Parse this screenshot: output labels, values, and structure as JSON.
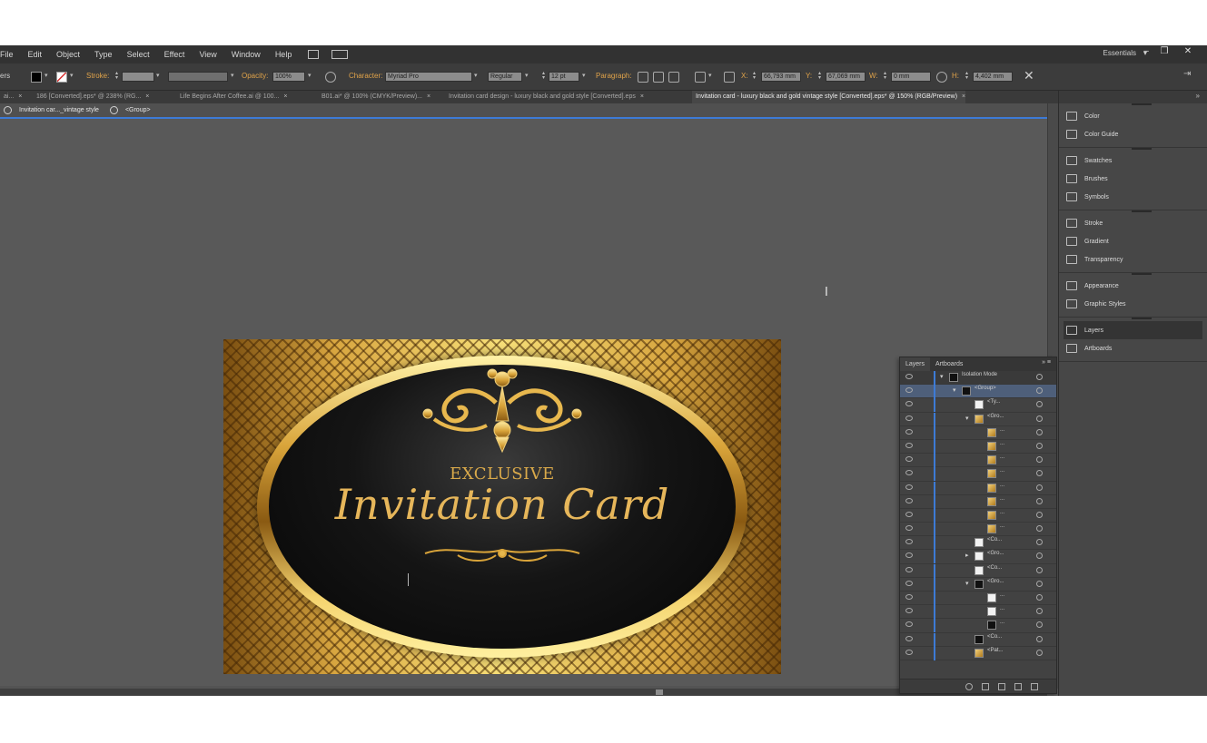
{
  "menubar": {
    "items": [
      "File",
      "Edit",
      "Object",
      "Type",
      "Select",
      "Effect",
      "View",
      "Window",
      "Help"
    ],
    "workspace_label": "Essentials",
    "workspace_caret": "▾",
    "win_minimize": "–",
    "win_restore": "❐",
    "win_close": "✕"
  },
  "controlbar": {
    "prefix_label": "ers",
    "stroke_label": "Stroke:",
    "opacity_label": "Opacity:",
    "opacity_value": "100%",
    "character_label": "Character:",
    "font_value": "Myriad Pro",
    "style_value": "Regular",
    "size_value": "12 pt",
    "paragraph_label": "Paragraph:",
    "x_label": "X:",
    "x_value": "66,793 mm",
    "y_label": "Y:",
    "y_value": "67,069 mm",
    "w_label": "W:",
    "w_value": "0 mm",
    "h_label": "H:",
    "h_value": "4,402 mm",
    "fill_color": "#000000",
    "stroke_color": "#d83030"
  },
  "tabs": [
    {
      "label": "ai..."
    },
    {
      "label": "186 [Converted].eps* @ 238% (RG..."
    },
    {
      "label": "Life Begins After Coffee.ai @ 100..."
    },
    {
      "label": "B01.ai* @ 100% (CMYK/Preview)..."
    },
    {
      "label": "Invitation card design - luxury black and gold style [Converted].eps"
    },
    {
      "label": "Invitation card - luxury black and gold vintage style [Converted].eps* @ 150% (RGB/Preview)"
    }
  ],
  "tab_close": "×",
  "breadcrumb": {
    "items": [
      "Invitation car..._vintage style",
      "<Group>"
    ]
  },
  "artwork": {
    "subtitle": "EXCLUSIVE",
    "title": "Invitation Card"
  },
  "cursor": {
    "ibeam": "I"
  },
  "dock": {
    "collapse": "»",
    "groups": [
      [
        {
          "label": "Color",
          "icon": "color-icon"
        },
        {
          "label": "Color Guide",
          "icon": "color-guide-icon"
        }
      ],
      [
        {
          "label": "Swatches",
          "icon": "swatches-icon"
        },
        {
          "label": "Brushes",
          "icon": "brushes-icon"
        },
        {
          "label": "Symbols",
          "icon": "symbols-icon"
        }
      ],
      [
        {
          "label": "Stroke",
          "icon": "stroke-icon"
        },
        {
          "label": "Gradient",
          "icon": "gradient-icon"
        },
        {
          "label": "Transparency",
          "icon": "transparency-icon"
        }
      ],
      [
        {
          "label": "Appearance",
          "icon": "appearance-icon"
        },
        {
          "label": "Graphic Styles",
          "icon": "graphic-styles-icon"
        }
      ],
      [
        {
          "label": "Layers",
          "icon": "layers-icon",
          "selected": true
        },
        {
          "label": "Artboards",
          "icon": "artboards-icon"
        }
      ]
    ]
  },
  "layers": {
    "tabs": [
      "Layers",
      "Artboards"
    ],
    "menu": "»  ≡",
    "rows": [
      {
        "name": "Isolation Mode",
        "depth": 0,
        "expander": "▾",
        "thumb": "black",
        "state": "isolated"
      },
      {
        "name": "<Group>",
        "depth": 1,
        "expander": "▾",
        "thumb": "black",
        "state": "selected"
      },
      {
        "name": "<Ty...",
        "depth": 2,
        "expander": "",
        "thumb": "white",
        "state": ""
      },
      {
        "name": "<Gro...",
        "depth": 2,
        "expander": "▾",
        "thumb": "gold",
        "state": ""
      },
      {
        "name": "...",
        "depth": 3,
        "expander": "",
        "thumb": "gold",
        "state": ""
      },
      {
        "name": "...",
        "depth": 3,
        "expander": "",
        "thumb": "gold",
        "state": ""
      },
      {
        "name": "...",
        "depth": 3,
        "expander": "",
        "thumb": "gold",
        "state": ""
      },
      {
        "name": "...",
        "depth": 3,
        "expander": "",
        "thumb": "gold",
        "state": ""
      },
      {
        "name": "...",
        "depth": 3,
        "expander": "",
        "thumb": "gold",
        "state": ""
      },
      {
        "name": "...",
        "depth": 3,
        "expander": "",
        "thumb": "gold",
        "state": ""
      },
      {
        "name": "...",
        "depth": 3,
        "expander": "",
        "thumb": "gold",
        "state": ""
      },
      {
        "name": "...",
        "depth": 3,
        "expander": "",
        "thumb": "gold",
        "state": ""
      },
      {
        "name": "<Co...",
        "depth": 2,
        "expander": "",
        "thumb": "white",
        "state": ""
      },
      {
        "name": "<Gro...",
        "depth": 2,
        "expander": "▸",
        "thumb": "white",
        "state": ""
      },
      {
        "name": "<Co...",
        "depth": 2,
        "expander": "",
        "thumb": "white",
        "state": ""
      },
      {
        "name": "<Gro...",
        "depth": 2,
        "expander": "▾",
        "thumb": "black",
        "state": ""
      },
      {
        "name": "...",
        "depth": 3,
        "expander": "",
        "thumb": "white",
        "state": ""
      },
      {
        "name": "...",
        "depth": 3,
        "expander": "",
        "thumb": "white",
        "state": ""
      },
      {
        "name": "...",
        "depth": 3,
        "expander": "",
        "thumb": "black",
        "state": ""
      },
      {
        "name": "<Co...",
        "depth": 2,
        "expander": "",
        "thumb": "black",
        "state": ""
      },
      {
        "name": "<Pat...",
        "depth": 2,
        "expander": "",
        "thumb": "gold",
        "state": ""
      }
    ]
  }
}
